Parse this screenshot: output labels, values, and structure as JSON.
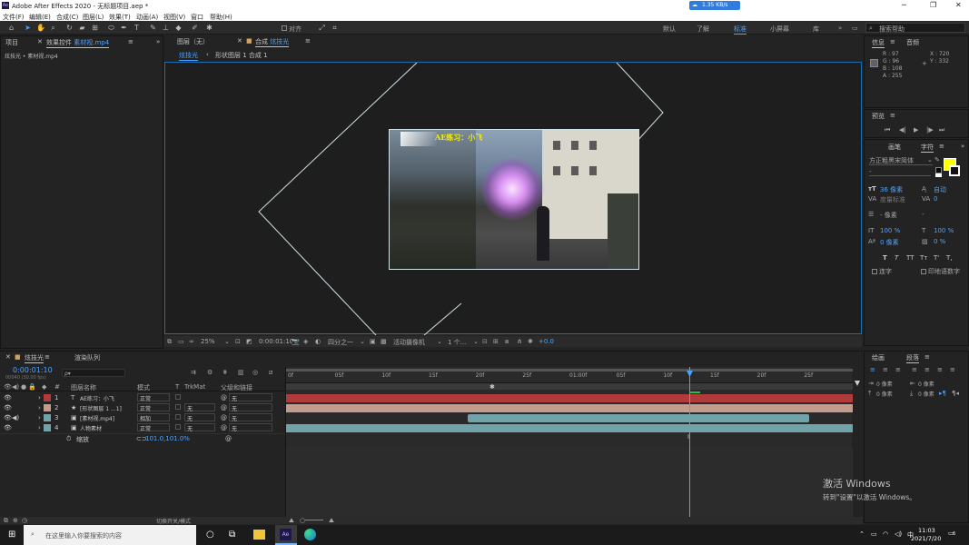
{
  "app": {
    "title": "Adobe After Effects 2020 - 无标题项目.aep *",
    "logo_text": "Ae",
    "speed_badge": "1.35 KB/s",
    "window_controls": [
      "─",
      "❐",
      "✕"
    ]
  },
  "menu": [
    "文件(F)",
    "编辑(E)",
    "合成(C)",
    "图层(L)",
    "效果(T)",
    "动画(A)",
    "视图(V)",
    "窗口",
    "帮助(H)"
  ],
  "toolbar": {
    "align_label": "对齐",
    "workspaces": [
      "默认",
      "了解",
      "标准",
      "小屏幕",
      "库"
    ],
    "active_workspace": "标准",
    "more": "»",
    "search_placeholder": "搜索帮助"
  },
  "project_panel": {
    "tab1": "项目",
    "tab2_prefix": "效果控件",
    "tab2_file": "素材视.mp4",
    "path": "炫技光 • 素材视.mp4"
  },
  "viewer": {
    "layer_tab": "图层（无）",
    "comp_tab_prefix": "合成",
    "comp_tab_name": "炫技光",
    "breadcrumb_active": "炫技光",
    "breadcrumb_next": "形状图层 1 合成 1",
    "overlay_text": "AE练习：小飞"
  },
  "viewer_footer": {
    "zoom": "25%",
    "timecode": "0:00:01:10",
    "resolution": "四分之一",
    "camera": "活动摄像机",
    "views": "1 个...",
    "exposure": "+0.0"
  },
  "info_panel": {
    "tab1": "信息",
    "tab2": "音频",
    "r": "R : 97",
    "g": "G : 96",
    "b": "B : 108",
    "a": "A : 255",
    "x": "X : 720",
    "y": "Y : 332"
  },
  "preview_panel": {
    "title": "预览",
    "buttons": [
      "⏮",
      "◀|",
      "▶",
      "|▶",
      "⏭"
    ]
  },
  "character_panel": {
    "tab1": "画笔",
    "tab2": "字符",
    "font": "方正粗黑宋简体",
    "style": "-",
    "size": "36 像素",
    "leading": "自动",
    "kerning": "度量标准",
    "tracking": "0",
    "stroke": "- 像素",
    "stroke_mode": "-",
    "vscale": "100 %",
    "hscale": "100 %",
    "baseline": "0 像素",
    "tsume": "0 %",
    "style_buttons": [
      "T",
      "T",
      "TT",
      "Tт",
      "T'",
      "T,"
    ],
    "ligature": "连字",
    "hindi": "印地语数字",
    "fill_color": "#ffff00"
  },
  "paragraph_panel": {
    "tab1": "绘画",
    "tab2": "段落",
    "indent_left": "0 像素",
    "indent_right": "0 像素",
    "space_before": "0 像素",
    "space_after": "0 像素"
  },
  "timeline": {
    "comp_tab": "炫技光",
    "render_tab": "渲染队列",
    "timecode": "0:00:01:10",
    "frame_info": "00040 (30.00 fps)",
    "search_placeholder": "ρ▾",
    "columns": {
      "name": "图层名称",
      "mode": "模式",
      "t": "T",
      "trkmat": "TrkMat",
      "parent": "父级和链接"
    },
    "ruler": [
      "0f",
      "05f",
      "10f",
      "15f",
      "20f",
      "25f",
      "01:00f",
      "05f",
      "10f",
      "15f",
      "20f",
      "25f"
    ],
    "layers": [
      {
        "num": "1",
        "type": "T",
        "name": "AE练习：小飞",
        "mode": "正常",
        "trk": "",
        "parent": "无",
        "color": "#b13b3b"
      },
      {
        "num": "2",
        "type": "★",
        "name": "[形状图层 1 ...1]",
        "mode": "正常",
        "trk": "无",
        "parent": "无",
        "color": "#c49c8e"
      },
      {
        "num": "3",
        "type": "▣",
        "name": "[素材视.mp4]",
        "mode": "相加",
        "trk": "无",
        "parent": "无",
        "color": "#72a3a8"
      },
      {
        "num": "4",
        "type": "▣",
        "name": "人物素材",
        "mode": "正常",
        "trk": "无",
        "parent": "无",
        "color": "#72a3a8"
      }
    ],
    "sub_prop_name": "缩放",
    "sub_prop_value": "101.0,101.0%",
    "footer_label": "切换开关/模式"
  },
  "watermark": {
    "line1": "激活 Windows",
    "line2": "转到\"设置\"以激活 Windows。"
  },
  "taskbar": {
    "search_placeholder": "在这里输入你要搜索的内容",
    "time": "11:03",
    "date": "2021/7/20",
    "ime": "中",
    "notif_count": "6"
  }
}
